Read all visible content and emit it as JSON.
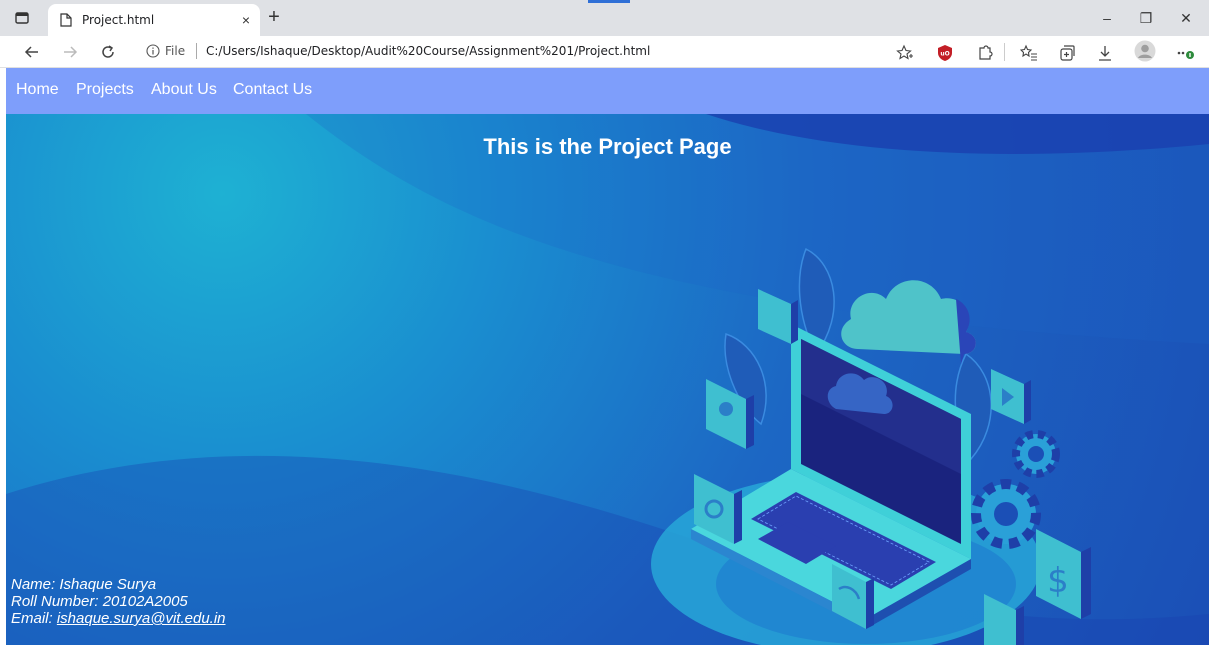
{
  "browser": {
    "tab_title": "Project.html",
    "tab_close": "×",
    "new_tab": "+",
    "file_label": "File",
    "url": "C:/Users/Ishaque/Desktop/Audit%20Course/Assignment%201/Project.html",
    "icons": [
      "tab-actions-icon",
      "file-icon",
      "close-icon",
      "plus-icon",
      "back-icon",
      "forward-icon",
      "refresh-icon",
      "info-icon",
      "add-favorite-icon",
      "ublock-icon",
      "extensions-icon",
      "favorites-icon",
      "collections-icon",
      "download-icon",
      "profile-icon",
      "more-icon"
    ],
    "window_controls": {
      "minimize": "–",
      "restore": "❐",
      "close": "✕"
    }
  },
  "nav": {
    "items": [
      "Home",
      "Projects",
      "About Us",
      "Contact Us"
    ]
  },
  "page": {
    "title": "This is the Project Page",
    "name_line": "Name: Ishaque Surya",
    "roll_line": "Roll Number: 20102A2005",
    "email_label": "Email: ",
    "email": "ishaque.surya@vit.edu.in"
  },
  "colors": {
    "navbar": "#7e9efb",
    "hero_light": "#1eb1d3",
    "hero_dark": "#1b4fb6",
    "laptop_screen": "#1a237e",
    "cloud": "#4fc3c9"
  }
}
